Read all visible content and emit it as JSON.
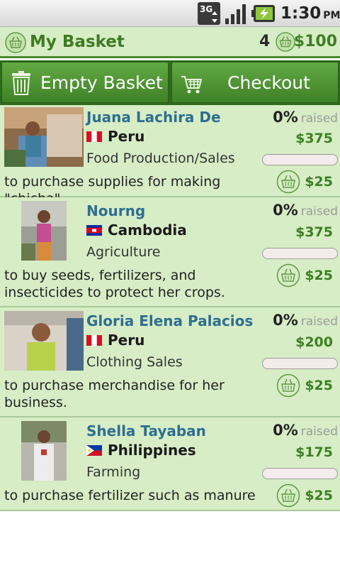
{
  "status_bar": {
    "network_icon": "3g-data-icon",
    "signal_icon": "signal-strength-icon",
    "battery_icon": "battery-charging-icon",
    "time": "1:30",
    "ampm": "PM"
  },
  "basket": {
    "icon": "basket-icon",
    "title": "My Basket",
    "count": "4",
    "total": "$100"
  },
  "actions": {
    "empty_label": "Empty Basket",
    "empty_icon": "trash-icon",
    "checkout_label": "Checkout",
    "checkout_icon": "cart-icon"
  },
  "colors": {
    "accent_green": "#3d7f23",
    "row_bg": "#d7edc6",
    "name_blue": "#2f6e8f"
  },
  "loans": [
    {
      "name": "Juana Lachira De",
      "country": "Peru",
      "flag": "peru-flag",
      "sector": "Food Production/Sales",
      "percent": "0%",
      "raised_label": "raised",
      "amount": "$375",
      "progress": 0,
      "use": "to purchase supplies for making \"chicha\".",
      "lend_icon": "basket-icon",
      "lend_amount": "$25"
    },
    {
      "name": "Nourng",
      "country": "Cambodia",
      "flag": "cambodia-flag",
      "sector": "Agriculture",
      "percent": "0%",
      "raised_label": "raised",
      "amount": "$375",
      "progress": 0,
      "use": "to buy seeds, fertilizers, and insecticides to protect her crops.",
      "lend_icon": "basket-icon",
      "lend_amount": "$25"
    },
    {
      "name": "Gloria Elena Palacios",
      "country": "Peru",
      "flag": "peru-flag",
      "sector": "Clothing Sales",
      "percent": "0%",
      "raised_label": "raised",
      "amount": "$200",
      "progress": 0,
      "use": "to purchase merchandise for her business.",
      "lend_icon": "basket-icon",
      "lend_amount": "$25"
    },
    {
      "name": "Shella Tayaban",
      "country": "Philippines",
      "flag": "philippines-flag",
      "sector": "Farming",
      "percent": "0%",
      "raised_label": "raised",
      "amount": "$175",
      "progress": 0,
      "use": "to purchase fertilizer such as manure",
      "lend_icon": "basket-icon",
      "lend_amount": "$25"
    }
  ]
}
